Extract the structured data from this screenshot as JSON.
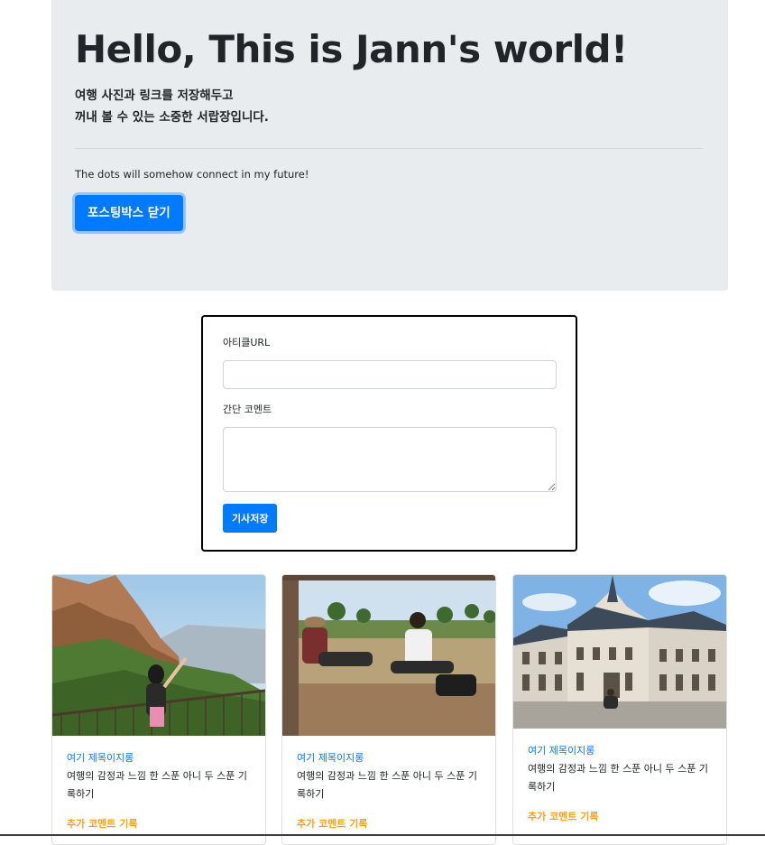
{
  "header": {
    "title": "Hello, This is Jann's world!",
    "lead_line1": "여행 사진과 링크를 저장해두고",
    "lead_line2": "꺼내 볼 수 있는 소중한 서랍장입니다.",
    "subtext": "The dots will somehow connect in my future!",
    "toggle_button": "포스팅박스 닫기"
  },
  "posting_box": {
    "url_label": "아티클URL",
    "url_value": "",
    "comment_label": "간단 코멘트",
    "comment_value": "",
    "save_button": "기사저장"
  },
  "cards": [
    {
      "title": "여기 제목이지롱",
      "text": "여행의 감정과 느낌 한 스푼 아니 두 스푼 기록하기",
      "extra": "추가 코멘트 기록"
    },
    {
      "title": "여기 제목이지롱",
      "text": "여행의 감정과 느낌 한 스푼 아니 두 스푼 기록하기",
      "extra": "추가 코멘트 기록"
    },
    {
      "title": "여기 제목이지롱",
      "text": "여행의 감정과 느낌 한 스푼 아니 두 스푼 기록하기",
      "extra": "추가 코멘트 기록"
    }
  ],
  "colors": {
    "primary": "#007bff",
    "jumbotron_bg": "#e9ecef",
    "accent_orange": "#ff9f1a"
  }
}
